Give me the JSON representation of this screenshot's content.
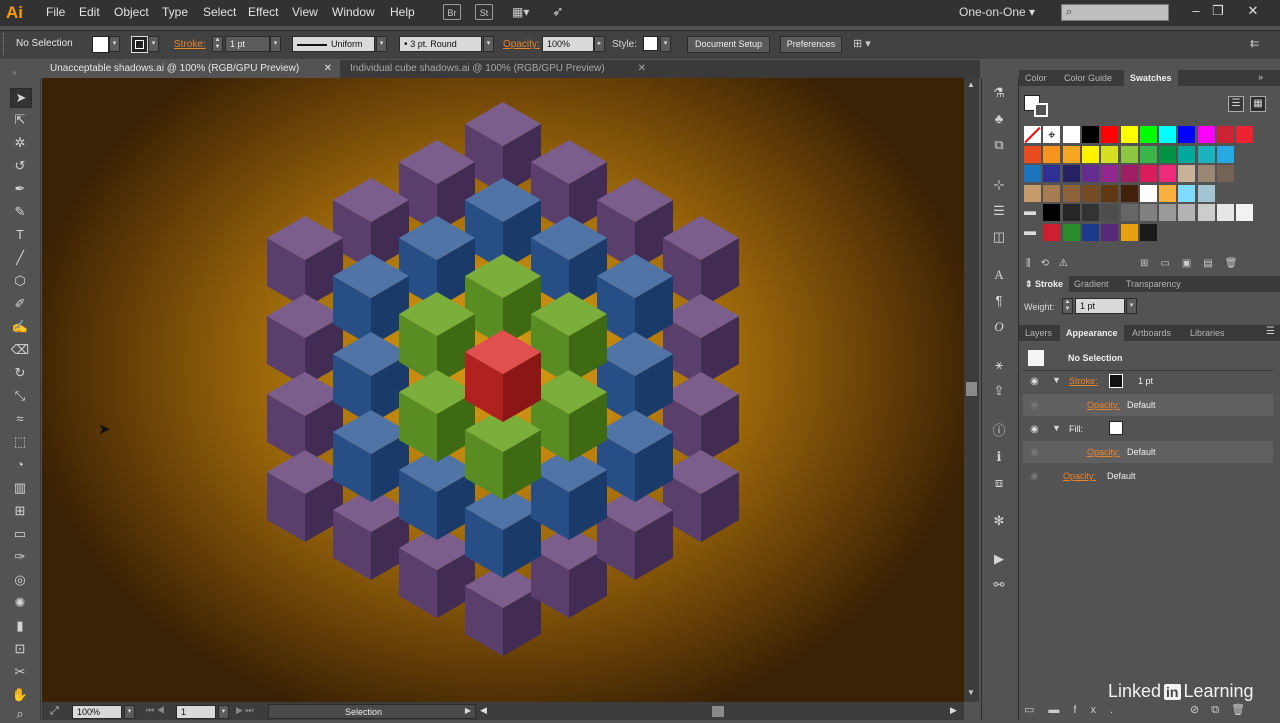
{
  "app": {
    "logo": "Ai"
  },
  "menu": [
    "File",
    "Edit",
    "Object",
    "Type",
    "Select",
    "Effect",
    "View",
    "Window",
    "Help"
  ],
  "menu_icons": [
    "Br",
    "St"
  ],
  "workspace": "One-on-One",
  "control": {
    "selection": "No Selection",
    "stroke_label": "Stroke:",
    "stroke_weight": "1 pt",
    "profile": "Uniform",
    "brush": "3 pt. Round",
    "opacity_label": "Opacity:",
    "opacity_value": "100%",
    "style_label": "Style:",
    "document_setup": "Document Setup",
    "preferences": "Preferences"
  },
  "tabs": [
    {
      "title": "Unacceptable shadows.ai @ 100% (RGB/GPU Preview)",
      "active": true
    },
    {
      "title": "Individual cube shadows.ai @ 100% (RGB/GPU Preview)",
      "active": false
    }
  ],
  "status": {
    "zoom": "100%",
    "artboard": "1",
    "tool": "Selection"
  },
  "swatches_panel": {
    "tabs": [
      "Color",
      "Color Guide",
      "Swatches"
    ],
    "active": "Swatches",
    "rows": [
      [
        "none",
        "reg",
        "#ffffff",
        "#000000",
        "#ff0000",
        "#ffff00",
        "#00ff00",
        "#00ffff",
        "#0000ff",
        "#ff00ff",
        "#cc2233",
        "#ee2233"
      ],
      [
        "#e84c1e",
        "#f7941d",
        "#f5a623",
        "#fff200",
        "#d7df23",
        "#8dc63f",
        "#39b54a",
        "#009444",
        "#00a99d",
        "#1bb3bc",
        "#27aae1"
      ],
      [
        "#1c75bc",
        "#2e3192",
        "#262262",
        "#662d91",
        "#92278f",
        "#9e1f63",
        "#da1c5c",
        "#ee2a7b",
        "#c7b299",
        "#998675",
        "#736357"
      ],
      [
        "#c69c6d",
        "#a67c52",
        "#8c6239",
        "#754c24",
        "#603913",
        "#42210b",
        "#ffffff",
        "#fbb040",
        "#7fdbff",
        "#a0c4d0"
      ],
      [
        "folder",
        "#000000",
        "#262626",
        "#333333",
        "#4d4d4d",
        "#666666",
        "#808080",
        "#999999",
        "#b3b3b3",
        "#cccccc",
        "#e6e6e6",
        "#f2f2f2"
      ],
      [
        "folder",
        "#cc2030",
        "#2a8c2a",
        "#1c3a8c",
        "#5a2a7a",
        "#e8a010",
        "#1a1a1a"
      ]
    ]
  },
  "stroke_panel": {
    "tabs": [
      "Stroke",
      "Gradient",
      "Transparency"
    ],
    "weight_label": "Weight:",
    "weight": "1 pt"
  },
  "appearance_panel": {
    "tabs": [
      "Layers",
      "Appearance",
      "Artboards",
      "Libraries"
    ],
    "active": "Appearance",
    "title": "No Selection",
    "stroke_label": "Stroke:",
    "stroke_value": "1 pt",
    "opacity_label": "Opacity:",
    "opacity_value": "Default",
    "fill_label": "Fill:"
  },
  "watermark": {
    "left": "Linked",
    "in": "in",
    "right": "Learning"
  },
  "colors": {
    "red_top": "#e0504e",
    "red_left": "#b02220",
    "red_right": "#8a1616",
    "green_top": "#7cae3c",
    "green_left": "#5a8c24",
    "green_right": "#3e6a14",
    "blue_top": "#5174a6",
    "blue_left": "#284e86",
    "blue_right": "#1a3a6a",
    "purple_top": "#7b5e8c",
    "purple_left": "#5a3e6c",
    "purple_right": "#432c54"
  }
}
